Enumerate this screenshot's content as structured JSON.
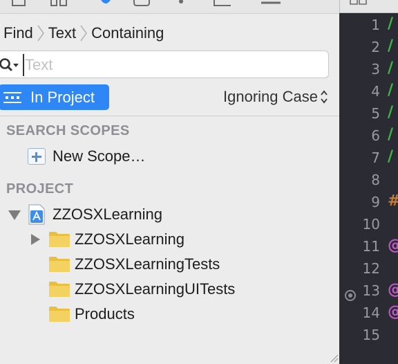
{
  "find_nav": {
    "breadcrumb": [
      "Find",
      "Text",
      "Containing"
    ],
    "search": {
      "value": "",
      "placeholder": "Text"
    },
    "scope_button": "In Project",
    "case_option": "Ignoring Case"
  },
  "search_scopes": {
    "header": "SEARCH SCOPES",
    "new_scope": "New Scope…"
  },
  "project": {
    "header": "PROJECT",
    "root": "ZZOSXLearning",
    "items": [
      "ZZOSXLearning",
      "ZZOSXLearningTests",
      "ZZOSXLearningUITests",
      "Products"
    ]
  },
  "editor": {
    "line_numbers": [
      "1",
      "2",
      "3",
      "4",
      "5",
      "6",
      "7",
      "8",
      "9",
      "10",
      "11",
      "12",
      "13",
      "14",
      "15"
    ],
    "marks": [
      "/",
      "/",
      "/",
      "/",
      "/",
      "/",
      "/",
      "",
      "#",
      "",
      "@",
      "",
      "@",
      "@",
      ""
    ]
  },
  "colors": {
    "accent": "#2f87f5",
    "folder": "#f2cf52",
    "comment_mark": "#41b645",
    "preprocessor_mark": "#c07b3a",
    "keyword_mark": "#c156c8"
  }
}
